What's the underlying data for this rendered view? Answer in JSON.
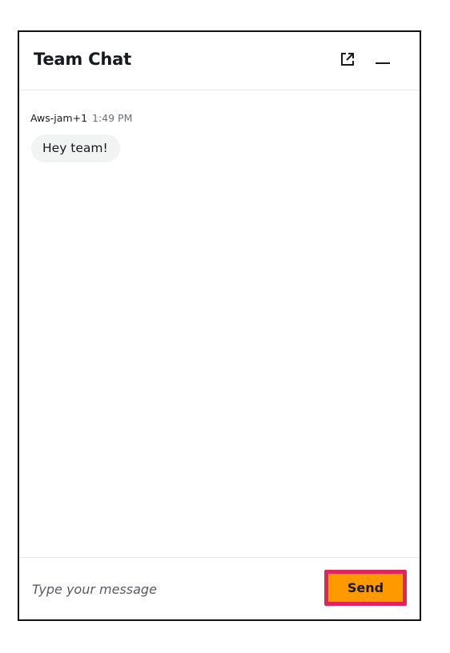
{
  "header": {
    "title": "Team Chat",
    "popout_icon": "external-link-icon",
    "minimize_icon": "minimize-icon"
  },
  "messages": [
    {
      "author": "Aws-jam+1",
      "time": "1:49 PM",
      "text": "Hey team!"
    }
  ],
  "composer": {
    "placeholder": "Type your message",
    "send_label": "Send"
  },
  "colors": {
    "send_button": "#ff9900",
    "highlight_frame": "#e0245e",
    "bubble_background": "#f2f3f3",
    "text_primary": "#16191f",
    "text_secondary": "#687078"
  }
}
